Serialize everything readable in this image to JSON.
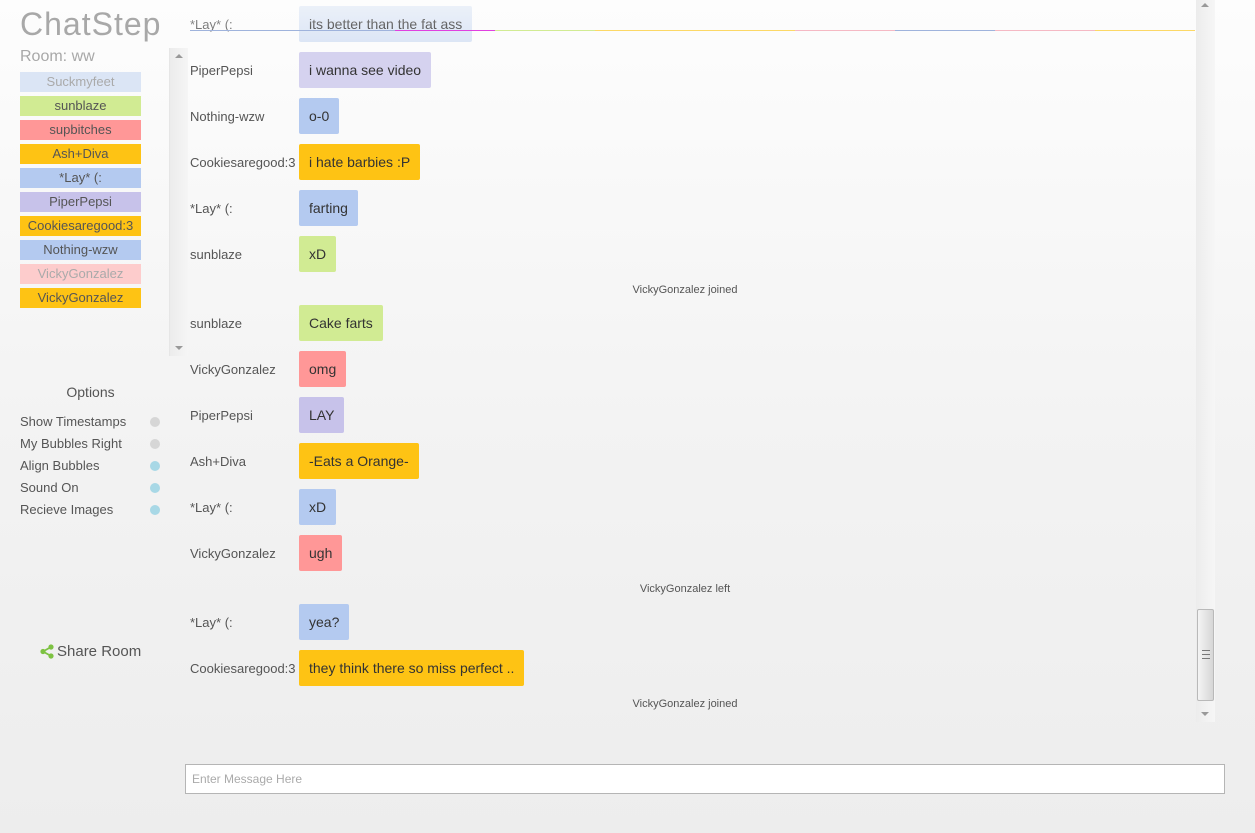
{
  "app": {
    "title": "ChatStep",
    "room_label": "Room: ww"
  },
  "colors": {
    "light_blue": "#dbe5f5",
    "green": "#d1eb93",
    "red": "#ff9797",
    "orange": "#fec314",
    "blue": "#b4caf0",
    "purple": "#c7c2ea",
    "pink": "#fdcccc",
    "dot_off": "#d6d6d6",
    "dot_on": "#a8d8e6",
    "share_green": "#7dc242"
  },
  "users": [
    {
      "name": "Suckmyfeet",
      "color": "#dbe5f5",
      "faded": true
    },
    {
      "name": "sunblaze",
      "color": "#d1eb93",
      "faded": false
    },
    {
      "name": "supbitches",
      "color": "#ff9797",
      "faded": false
    },
    {
      "name": "Ash+Diva",
      "color": "#fec314",
      "faded": false
    },
    {
      "name": "*Lay* (:",
      "color": "#b4caf0",
      "faded": false
    },
    {
      "name": "PiperPepsi",
      "color": "#c7c2ea",
      "faded": false
    },
    {
      "name": "Cookiesaregood:3",
      "color": "#fec314",
      "faded": false
    },
    {
      "name": "Nothing-wzw",
      "color": "#b4caf0",
      "faded": false
    },
    {
      "name": "VickyGonzalez",
      "color": "#fdcccc",
      "faded": true
    },
    {
      "name": "VickyGonzalez",
      "color": "#fec314",
      "faded": false
    }
  ],
  "options": {
    "title": "Options",
    "items": [
      {
        "label": "Show Timestamps",
        "enabled": false
      },
      {
        "label": "My Bubbles Right",
        "enabled": false
      },
      {
        "label": "Align Bubbles",
        "enabled": true
      },
      {
        "label": "Sound On",
        "enabled": true
      },
      {
        "label": "Recieve Images",
        "enabled": true
      }
    ]
  },
  "share": {
    "label": "Share Room",
    "icon": "share-icon"
  },
  "messages": [
    {
      "type": "msg",
      "name": "*Lay* (:",
      "text": "its better than the fat ass",
      "color": "#dbe5f5"
    },
    {
      "type": "msg",
      "name": "PiperPepsi",
      "text": "i wanna see video",
      "color": "#d5d2ef"
    },
    {
      "type": "msg",
      "name": "Nothing-wzw",
      "text": "o-0",
      "color": "#b4caf0"
    },
    {
      "type": "msg",
      "name": "Cookiesaregood:3",
      "text": "i hate barbies :P",
      "color": "#fec314"
    },
    {
      "type": "msg",
      "name": "*Lay* (:",
      "text": "farting",
      "color": "#b4caf0"
    },
    {
      "type": "msg",
      "name": "sunblaze",
      "text": "xD",
      "color": "#d1eb93"
    },
    {
      "type": "sys",
      "text": "VickyGonzalez joined"
    },
    {
      "type": "msg",
      "name": "sunblaze",
      "text": "Cake farts",
      "color": "#d1eb93"
    },
    {
      "type": "msg",
      "name": "VickyGonzalez",
      "text": "omg",
      "color": "#ff9797"
    },
    {
      "type": "msg",
      "name": "PiperPepsi",
      "text": "LAY",
      "color": "#c7c2ea"
    },
    {
      "type": "msg",
      "name": "Ash+Diva",
      "text": "-Eats a Orange-",
      "color": "#fec314"
    },
    {
      "type": "msg",
      "name": "*Lay* (:",
      "text": "xD",
      "color": "#b4caf0"
    },
    {
      "type": "msg",
      "name": "VickyGonzalez",
      "text": "ugh",
      "color": "#ff9797"
    },
    {
      "type": "sys",
      "text": "VickyGonzalez left"
    },
    {
      "type": "msg",
      "name": "*Lay* (:",
      "text": "yea?",
      "color": "#b4caf0"
    },
    {
      "type": "msg",
      "name": "Cookiesaregood:3",
      "text": "they think there so miss perfect ..",
      "color": "#fec314"
    },
    {
      "type": "sys",
      "text": "VickyGonzalez joined"
    }
  ],
  "typing_line_colors": [
    "#9fb3dc",
    "#e040e0",
    "#d1eb93",
    "#fcd866",
    "#f5b9c4",
    "#9fb3dc",
    "#f5b9c4",
    "#fcd866"
  ],
  "input": {
    "placeholder": "Enter Message Here",
    "value": ""
  }
}
